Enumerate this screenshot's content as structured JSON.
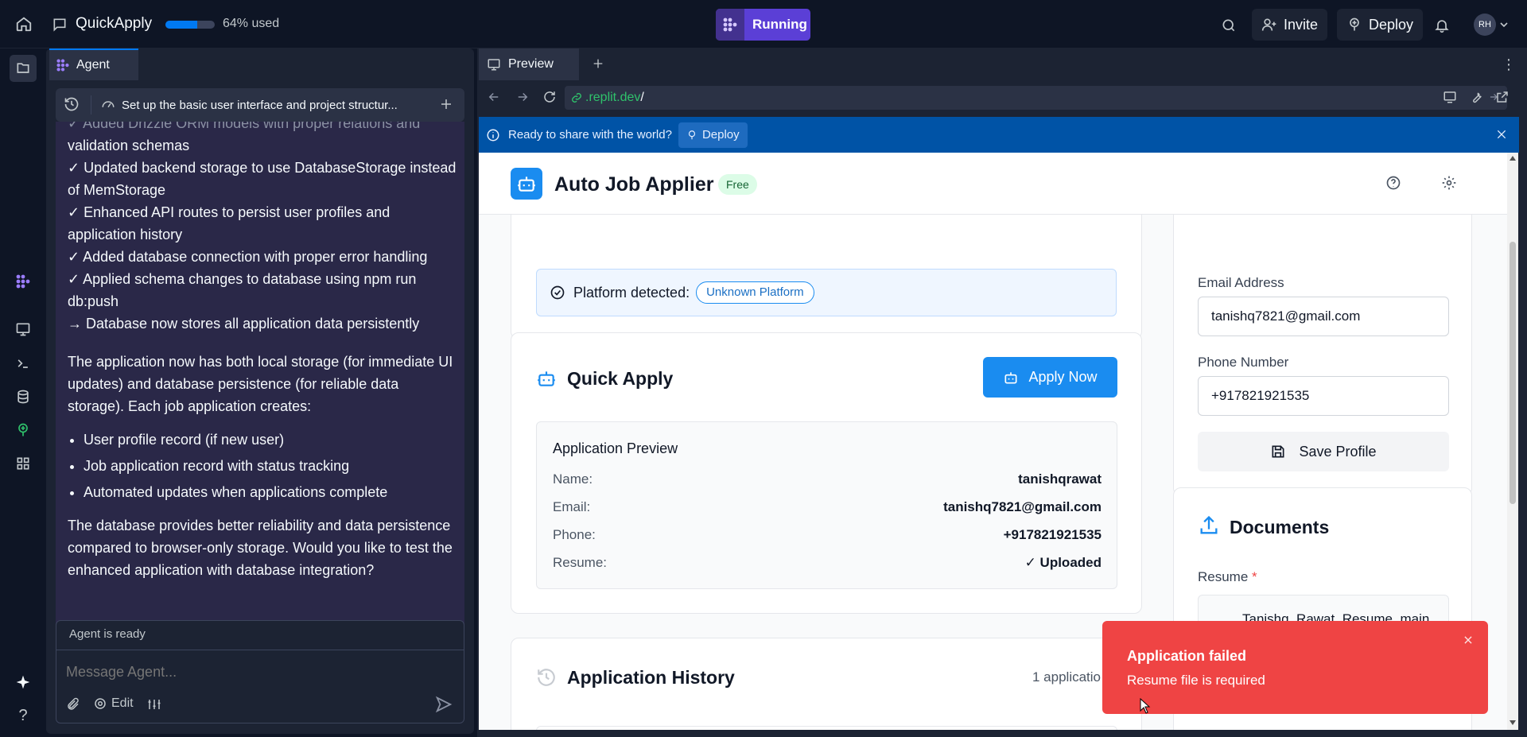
{
  "topbar": {
    "app_name": "QuickApply",
    "usage_percent": 64,
    "usage_label": "64% used",
    "run_label": "Running",
    "invite_label": "Invite",
    "deploy_label": "Deploy",
    "avatar_initials": "RH"
  },
  "agent": {
    "tab_label": "Agent",
    "task_title": "Set up the basic user interface and project structur...",
    "message": {
      "partial_top": "✓ Added Drizzle ORM models with proper relations and",
      "lines": [
        "validation schemas",
        "✓ Updated backend storage to use DatabaseStorage instead of MemStorage",
        "✓ Enhanced API routes to persist user profiles and application history",
        "✓ Added database connection with proper error handling",
        "✓ Applied schema changes to database using npm run db:push",
        "→ Database now stores all application data persistently"
      ],
      "para1": "The application now has both local storage (for immediate UI updates) and database persistence (for reliable data storage). Each job application creates:",
      "bullets": [
        "User profile record (if new user)",
        "Job application record with status tracking",
        "Automated updates when applications complete"
      ],
      "para2": "The database provides better reliability and data persistence compared to browser-only storage. Would you like to test the enhanced application with database integration?"
    },
    "status": "Agent is ready",
    "input_placeholder": "Message Agent...",
    "edit_label": "Edit"
  },
  "preview": {
    "tab_label": "Preview",
    "url_domain": ".replit.dev",
    "url_path": "/",
    "banner_text": "Ready to share with the world?",
    "banner_deploy": "Deploy"
  },
  "app": {
    "title": "Auto Job Applier",
    "plan_badge": "Free",
    "platform_label": "Platform detected:",
    "platform_value": "Unknown Platform",
    "quick_apply_title": "Quick Apply",
    "apply_now": "Apply Now",
    "preview_title": "Application Preview",
    "preview_rows": [
      {
        "key": "Name:",
        "value": "tanishqrawat"
      },
      {
        "key": "Email:",
        "value": "tanishq7821@gmail.com"
      },
      {
        "key": "Phone:",
        "value": "+917821921535"
      },
      {
        "key": "Resume:",
        "value": "✓ Uploaded"
      }
    ],
    "history_title": "Application History",
    "history_count": "1 applicatio",
    "email_label": "Email Address",
    "email_value": "tanishq7821@gmail.com",
    "phone_label": "Phone Number",
    "phone_value": "+917821921535",
    "save_profile": "Save Profile",
    "documents_title": "Documents",
    "resume_label": "Resume",
    "resume_required_mark": "*",
    "resume_file": "Tanishq_Rawat_Resume_main"
  },
  "toast": {
    "title": "Application failed",
    "message": "Resume file is required"
  },
  "colors": {
    "accent": "#0079f2",
    "running": "#5b3fd6",
    "error": "#ef4444",
    "app_blue": "#1a8cf0"
  }
}
